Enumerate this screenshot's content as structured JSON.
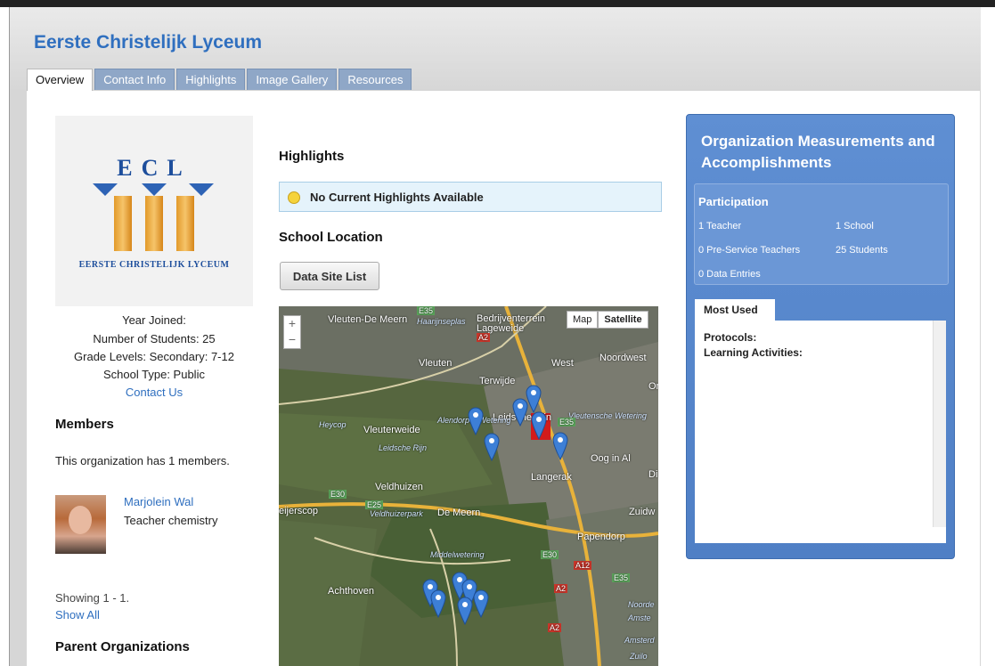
{
  "org": {
    "title": "Eerste Christelijk Lyceum"
  },
  "tabs": [
    "Overview",
    "Contact Info",
    "Highlights",
    "Image Gallery",
    "Resources"
  ],
  "logo": {
    "letters": "ECL",
    "subtitle": "EERSTE CHRISTELIJK LYCEUM"
  },
  "profile": {
    "year_joined": "Year Joined:",
    "students": "Number of Students: 25",
    "grades": "Grade Levels: Secondary: 7-12",
    "school_type": "School Type: Public",
    "contact": "Contact Us"
  },
  "members": {
    "heading": "Members",
    "summary": "This organization has 1 members.",
    "list": [
      {
        "name": "Marjolein Wal",
        "role": "Teacher chemistry"
      }
    ],
    "showing": "Showing 1 - 1.",
    "show_all": "Show All"
  },
  "parents": {
    "heading": "Parent Organizations"
  },
  "highlights": {
    "heading": "Highlights",
    "empty": "No Current Highlights Available"
  },
  "location": {
    "heading": "School Location",
    "button": "Data Site List",
    "map_type": {
      "map": "Map",
      "satellite": "Satellite"
    },
    "zoom": {
      "in": "+",
      "out": "−"
    },
    "labels": [
      "Vleuten-De Meern",
      "Haarijnseplas",
      "Bedrijventerrein Lageweide",
      "Vleuten",
      "West",
      "Noordwest",
      "Terwijde",
      "Leidsche Rijn",
      "Vleutensche Wetering",
      "Heycop",
      "Vleuterweide",
      "Alendorper Wetering",
      "Leidsche Rijn",
      "Oog in Al",
      "Langerak",
      "Veldhuizen",
      "eijerscop",
      "Veldhuizerpark",
      "De Meern",
      "Zuidw",
      "Papendorp",
      "Middelwetering",
      "Achthoven",
      "Noorde",
      "Amste",
      "Amsterd",
      "Zuilo",
      "E35",
      "A2",
      "E35",
      "E30",
      "E25",
      "E30",
      "A12",
      "A2",
      "E35",
      "A2",
      "Or",
      "Di"
    ]
  },
  "sidebar": {
    "title": "Organization Measurements and Accomplishments",
    "participation": {
      "title": "Participation",
      "stats": [
        "1 Teacher",
        "1 School",
        "0 Pre-Service Teachers",
        "25 Students",
        "0 Data Entries"
      ]
    },
    "most_used": {
      "tab": "Most Used",
      "protocols": "Protocols:",
      "activities": "Learning Activities:"
    }
  }
}
